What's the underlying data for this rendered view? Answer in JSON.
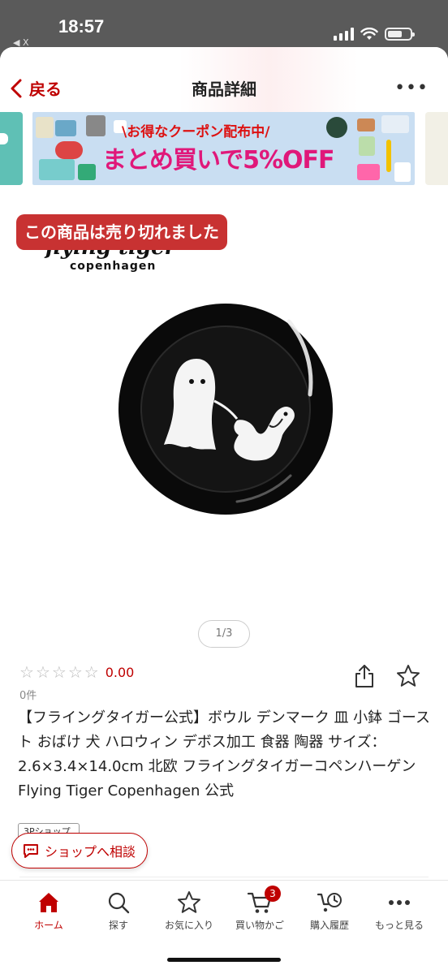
{
  "status_bar": {
    "time": "18:57",
    "back_app": "◀ X"
  },
  "nav": {
    "back_label": "戻る",
    "title": "商品詳細",
    "more_label": "•••"
  },
  "banner": {
    "line1": "\\お得なクーポン配布中/",
    "line2": "まとめ買いで5%OFF"
  },
  "product": {
    "sold_out_label": "この商品は売り切れました",
    "brand_line1": "flying tiger",
    "brand_line2": "copenhagen",
    "image_pager": "1/3",
    "rating_value": "0.00",
    "review_count": "0件",
    "title": "【フライングタイガー公式】ボウル デンマーク 皿 小鉢 ゴースト おばけ 犬 ハロウィン デボス加工 食器 陶器 サイズ：2.6×3.4×14.0cm 北欧 フライングタイガーコペンハーゲン Flying Tiger Copenhagen 公式",
    "points_badge": "3Pショップ",
    "stars": [
      "☆",
      "☆",
      "☆",
      "☆",
      "☆"
    ]
  },
  "consult_button": {
    "label": "ショップへ相談"
  },
  "tabbar": {
    "tabs": [
      {
        "label": "ホーム",
        "icon": "home-icon",
        "active": true
      },
      {
        "label": "探す",
        "icon": "search-icon"
      },
      {
        "label": "お気に入り",
        "icon": "star-icon"
      },
      {
        "label": "買い物かご",
        "icon": "cart-icon",
        "badge": "3"
      },
      {
        "label": "購入履歴",
        "icon": "history-icon"
      },
      {
        "label": "もっと見る",
        "icon": "more-icon"
      }
    ]
  },
  "colors": {
    "accent": "#bf0000",
    "sold_out_bg": "#c83232",
    "banner_bg": "#c9def2"
  }
}
